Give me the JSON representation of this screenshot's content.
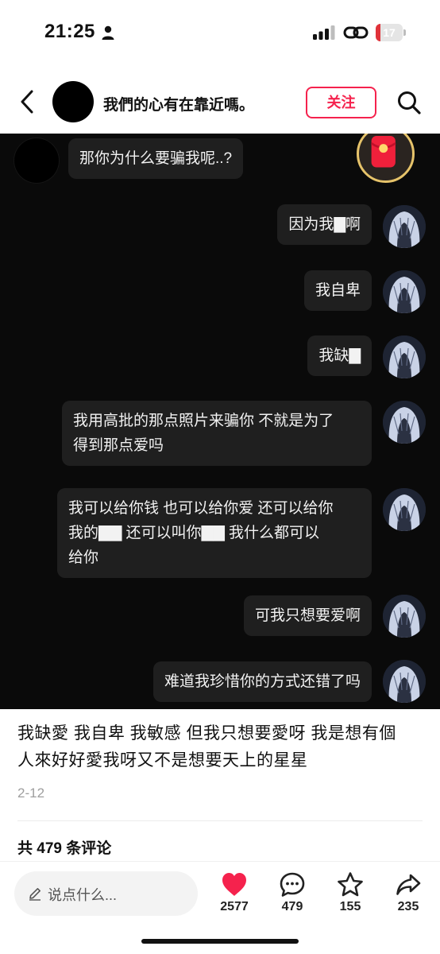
{
  "status_bar": {
    "time": "21:25",
    "battery_level": "17",
    "battery_fraction": 0.17,
    "icons": [
      "person-icon",
      "signal-icon",
      "link-icon",
      "battery-icon"
    ]
  },
  "header": {
    "author_name": "我們的心有在靠近嗎。",
    "follow_label": "关注",
    "icons": [
      "back-icon",
      "search-icon"
    ]
  },
  "chat": {
    "incoming": [
      {
        "text": "那你为什么要骗我呢..?"
      }
    ],
    "outgoing": [
      {
        "text": "因为我▇啊"
      },
      {
        "text": "我自卑"
      },
      {
        "text": "我缺▇"
      },
      {
        "lines": [
          "我用高批的那点照片来骗你 不就是为了",
          "得到那点爱吗"
        ]
      },
      {
        "lines": [
          "我可以给你钱 也可以给你爱 还可以给你",
          "我的▇▇ 还可以叫你▇▇ 我什么都可以",
          "给你"
        ]
      },
      {
        "text": "可我只想要爱啊"
      },
      {
        "text": "难道我珍惜你的方式还错了吗"
      }
    ],
    "close_symbol": "×"
  },
  "post": {
    "caption_lines": [
      "我缺愛 我自卑 我敏感 但我只想要愛呀 我是想有個",
      "人來好好愛我呀又不是想要天上的星星"
    ],
    "date": "2-12",
    "comment_count": "共 479 条评论"
  },
  "bottom_bar": {
    "input_placeholder": "说点什么...",
    "likes": "2577",
    "comments": "479",
    "favorites": "155",
    "shares": "235"
  },
  "colors": {
    "accent": "#f5224d",
    "chat_bg": "#0a0a0a",
    "bubble_bg": "#1f1f1f",
    "battery_red": "#e0323a"
  }
}
